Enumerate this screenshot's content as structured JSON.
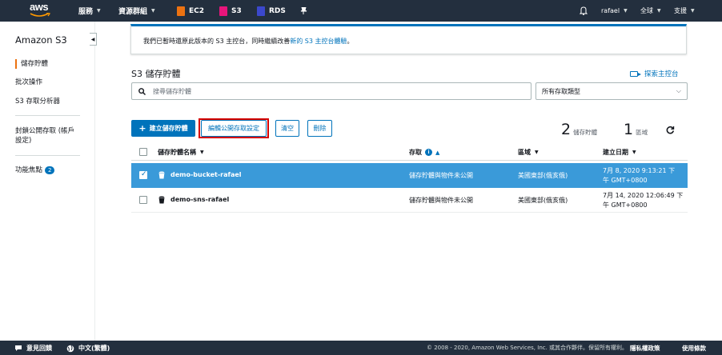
{
  "topnav": {
    "logo_text": "aws",
    "services": "服務",
    "resource_groups": "資源群組",
    "pinned": [
      {
        "label": "EC2",
        "icon": "ec2-icon",
        "color": "#ec7211"
      },
      {
        "label": "S3",
        "icon": "s3-icon",
        "color": "#e7157b"
      },
      {
        "label": "RDS",
        "icon": "rds-icon",
        "color": "#3b48cc"
      }
    ],
    "user": "rafael",
    "region": "全球",
    "support": "支援"
  },
  "sidebar": {
    "title": "Amazon S3",
    "items": [
      {
        "label": "儲存貯體"
      },
      {
        "label": "批次操作"
      },
      {
        "label": "S3 存取分析器"
      },
      {
        "label": "封鎖公開存取 (帳戶\n設定)"
      },
      {
        "label": "功能焦點",
        "badge": "2"
      }
    ]
  },
  "flash": {
    "text": "我們已暫時還原此版本的 S3 主控台，同時繼續改善",
    "link": "新的 S3 主控台體驗",
    "suffix": "。"
  },
  "page": {
    "title": "S3 儲存貯體",
    "explore_link": "探索主控台"
  },
  "search": {
    "placeholder": "搜尋儲存貯體"
  },
  "filter": {
    "selected": "所有存取類型"
  },
  "actions": {
    "create": "建立儲存貯體",
    "edit_public_access": "編輯公開存取設定",
    "empty": "清空",
    "delete": "刪除"
  },
  "stats": {
    "buckets_count": "2",
    "buckets_label": "儲存貯體",
    "regions_count": "1",
    "regions_label": "區域"
  },
  "table": {
    "columns": [
      "儲存貯體名稱",
      "存取",
      "區域",
      "建立日期"
    ],
    "rows": [
      {
        "name": "demo-bucket-rafael",
        "access": "儲存貯體與物件未公開",
        "region": "美國東部(俄亥俄)",
        "date_line1": "7月 8, 2020 9:13:21 下",
        "date_line2": "午 GMT+0800",
        "selected": true
      },
      {
        "name": "demo-sns-rafael",
        "access": "儲存貯體與物件未公開",
        "region": "美國東部(俄亥俄)",
        "date_line1": "7月 14, 2020 12:06:49 下",
        "date_line2": "午 GMT+0800",
        "selected": false
      }
    ]
  },
  "footer": {
    "feedback": "意見回饋",
    "language": "中文(繁體)",
    "copyright": "© 2008 - 2020, Amazon Web Services, Inc. 或其合作夥伴。保留所有權利。",
    "privacy": "隱私權政策",
    "terms": "使用條款"
  },
  "colors": {
    "nav_bg": "#232f3e",
    "primary": "#0073bb",
    "selected_row": "#3a9ad9",
    "highlight_border": "#d60000"
  }
}
